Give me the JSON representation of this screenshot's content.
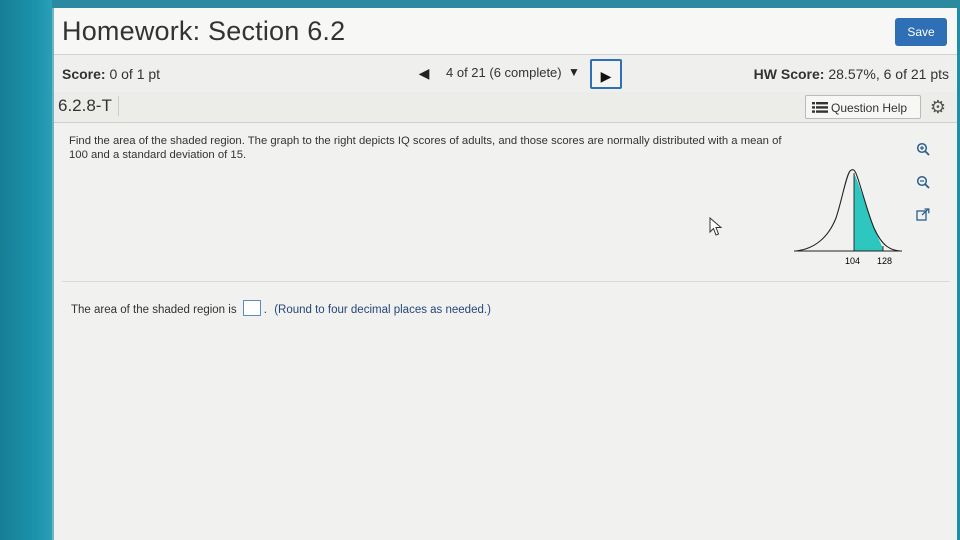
{
  "header": {
    "title": "Homework: Section 6.2",
    "save_label": "Save"
  },
  "score": {
    "label": "Score:",
    "value": "0 of 1 pt"
  },
  "navigation": {
    "prev_icon": "triangle-left-icon",
    "status": "4 of 21 (6 complete)",
    "dropdown_icon": "caret-down-icon",
    "next_icon": "triangle-right-icon"
  },
  "hw_score": {
    "label": "HW Score:",
    "value": "28.57%, 6 of 21 pts"
  },
  "question_bar": {
    "id": "6.2.8-T",
    "help_label": "Question Help",
    "help_icon": "list-icon",
    "settings_icon": "gear-icon"
  },
  "question": {
    "text": "Find the area of the shaded region. The graph to the right depicts IQ scores of adults, and those scores are normally distributed with a mean of 100 and a standard deviation of 15."
  },
  "graph": {
    "ticks": [
      "104",
      "128"
    ],
    "shade_color": "#2ec7c0"
  },
  "tools": {
    "zoom_in_icon": "zoom-in-icon",
    "zoom_out_icon": "zoom-out-icon",
    "popout_icon": "popout-icon"
  },
  "answer": {
    "prefix": "The area of the shaded region is",
    "hint": "(Round to four decimal places as needed.)"
  },
  "colors": {
    "accent": "#2e6fb6",
    "background": "#f1f1ef",
    "hint_text": "#27467a"
  }
}
